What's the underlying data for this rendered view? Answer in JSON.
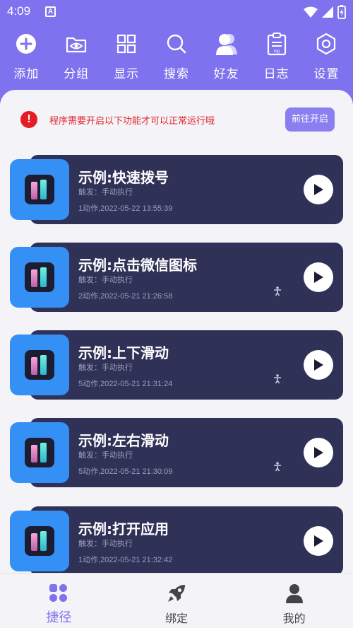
{
  "status_bar": {
    "time": "4:09",
    "notification_icon": "A"
  },
  "toolbar": [
    {
      "label": "添加",
      "icon": "plus-circle-icon"
    },
    {
      "label": "分组",
      "icon": "folder-eye-icon"
    },
    {
      "label": "显示",
      "icon": "grid-icon"
    },
    {
      "label": "搜索",
      "icon": "search-icon"
    },
    {
      "label": "好友",
      "icon": "friends-icon"
    },
    {
      "label": "日志",
      "icon": "log-icon"
    },
    {
      "label": "设置",
      "icon": "settings-hexagon-icon"
    }
  ],
  "notice": {
    "text": "程序需要开启以下功能才可以正常运行哦",
    "button": "前往开启"
  },
  "scripts": [
    {
      "title": "示例:快速拨号",
      "trigger": "触发：手动执行",
      "meta": "1动作,2022-05-22 13:55:39",
      "accessibility": false
    },
    {
      "title": "示例:点击微信图标",
      "trigger": "触发：手动执行",
      "meta": "2动作,2022-05-21 21:26:58",
      "accessibility": true
    },
    {
      "title": "示例:上下滑动",
      "trigger": "触发：手动执行",
      "meta": "5动作,2022-05-21 21:31:24",
      "accessibility": true
    },
    {
      "title": "示例:左右滑动",
      "trigger": "触发：手动执行",
      "meta": "5动作,2022-05-21 21:30:09",
      "accessibility": true
    },
    {
      "title": "示例:打开应用",
      "trigger": "触发：手动执行",
      "meta": "1动作,2022-05-21 21:32:42",
      "accessibility": false
    }
  ],
  "bottom_nav": [
    {
      "label": "捷径",
      "icon": "shortcut-grid-icon",
      "active": true
    },
    {
      "label": "绑定",
      "icon": "rocket-icon",
      "active": false
    },
    {
      "label": "我的",
      "icon": "person-icon",
      "active": false
    }
  ],
  "colors": {
    "header": "#7f72ee",
    "card": "#2f3157",
    "app_icon": "#3590f6",
    "warning": "#e51c23"
  }
}
